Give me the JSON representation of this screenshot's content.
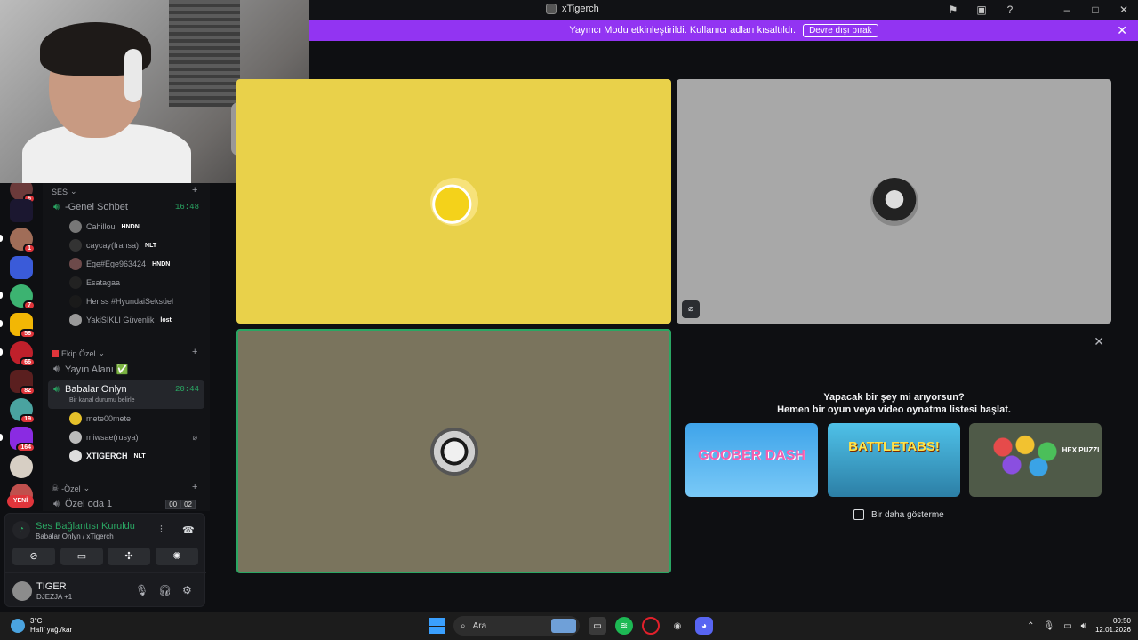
{
  "window": {
    "title": "xTigerch"
  },
  "banner": {
    "text": "Yayıncı Modu etkinleştirildi. Kullanıcı adları kısaltıldı.",
    "button": "Devre dışı bırak"
  },
  "servers": {
    "badges": [
      "6",
      "1",
      "7",
      "56",
      "66",
      "82",
      "19",
      "164"
    ],
    "new_label": "YENİ"
  },
  "channels": {
    "ses_category": "SES",
    "genel": {
      "name": "-Genel Sohbet",
      "time": "16:48"
    },
    "genel_users": [
      {
        "name": "Cahillou",
        "tag": "HNDN"
      },
      {
        "name": "caycay(fransa)",
        "tag": "NLT"
      },
      {
        "name": "Ege#Ege963424",
        "tag": "HNDN"
      },
      {
        "name": "Esatagaa",
        "tag": ""
      },
      {
        "name": "Henss #HyundaiSeksüel",
        "tag": ""
      },
      {
        "name": "YakiSİKLİ Güvenlik",
        "tag": "lost"
      }
    ],
    "ekip_category": "Ekip Özel",
    "yayin": "Yayın Alanı ✅",
    "babalar": {
      "name": "Babalar Onlyn",
      "time": "20:44",
      "status": "Bir kanal durumu belirle"
    },
    "babalar_users": [
      {
        "name": "mete00mete",
        "tag": ""
      },
      {
        "name": "miwsae(rusya)",
        "tag": ""
      },
      {
        "name": "XTİGERCH",
        "tag": "NLT"
      }
    ],
    "ozel_category": "-Özel",
    "ozel_oda": {
      "name": "Özel oda 1",
      "count_a": "00",
      "count_b": "02"
    }
  },
  "voice": {
    "status": "Ses Bağlantısı Kuruldu",
    "sub": "Babalar Onlyn / xTigerch"
  },
  "me": {
    "name": "TIGER",
    "activity": "DJEZJA +1"
  },
  "activity": {
    "question": "Yapacak bir şey mi arıyorsun?",
    "subtitle": "Hemen bir oyun veya video oynatma listesi başlat.",
    "games": [
      "GOOBER DASH",
      "BATTLETABS!",
      "HEX PUZZLE"
    ],
    "dont_show": "Bir daha gösterme"
  },
  "taskbar": {
    "temp": "3°C",
    "weather": "Hafif yağ./kar",
    "search": "Ara",
    "time": "00:50",
    "date": "12.01.2026"
  },
  "colors": {
    "accent": "#9234f2",
    "speaking": "#2aa663",
    "yellow_tile": "#e9d14a",
    "grey_tile": "#a8a8a8",
    "olive_tile": "#7a745d"
  }
}
